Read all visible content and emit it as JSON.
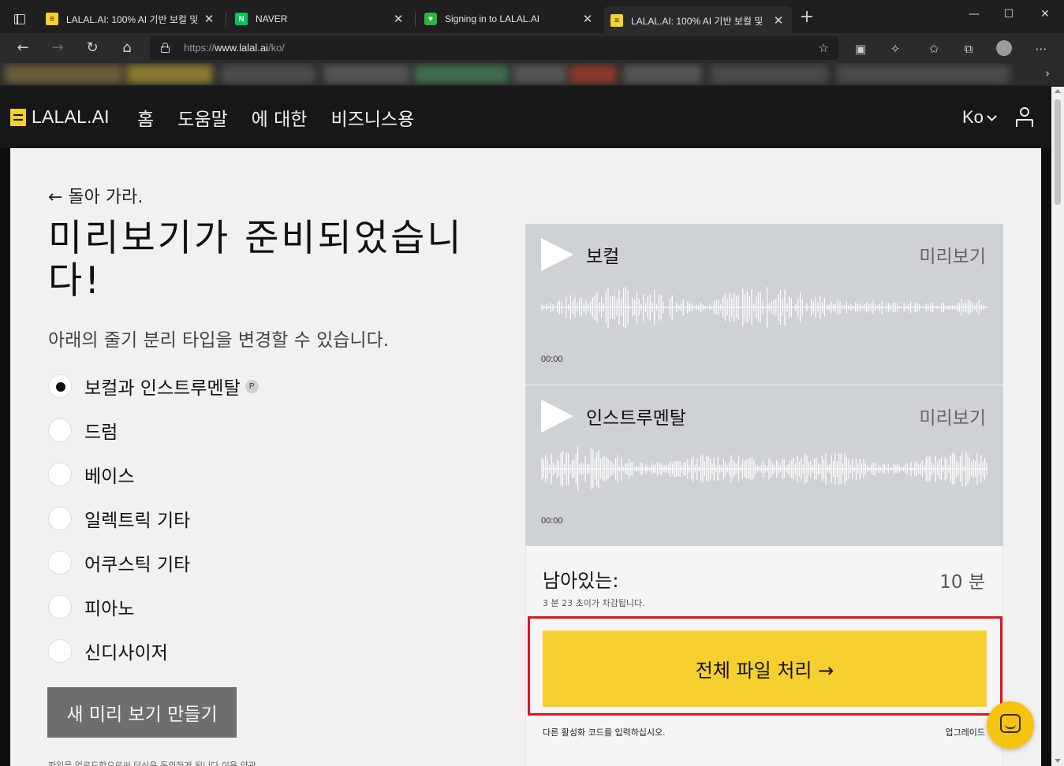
{
  "browser": {
    "tabs": [
      {
        "title": "LALAL.AI: 100% AI 기반 보컬 및 ",
        "favicon_color": "#f6d02e"
      },
      {
        "title": "NAVER",
        "favicon_color": "#03c75a"
      },
      {
        "title": "Signing in to LALAL.AI",
        "favicon_color": "#2fb344"
      },
      {
        "title": "LALAL.AI: 100% AI 기반 보컬 및 ",
        "favicon_color": "#f6d02e",
        "active": true
      }
    ],
    "new_tab": "+",
    "window": {
      "minimize": "—",
      "maximize": "☐",
      "close": "✕"
    },
    "url_scheme": "https://",
    "url_host": "www.lalal.ai",
    "url_path": "/ko/"
  },
  "site": {
    "logo": "LALAL.AI",
    "nav": [
      "홈",
      "도움말",
      "에 대한",
      "비즈니스용"
    ],
    "lang": "Ko",
    "accent": "#f6d02e"
  },
  "main": {
    "back": "← 돌아 가라.",
    "headline": "미리보기가 준비되었습니다!",
    "subline": "아래의 줄기 분리 타입을 변경할 수 있습니다.",
    "options": [
      {
        "label": "보컬과 인스트루멘탈",
        "selected": true,
        "badge": "P"
      },
      {
        "label": "드럼",
        "selected": false
      },
      {
        "label": "베이스",
        "selected": false
      },
      {
        "label": "일렉트릭 기타",
        "selected": false
      },
      {
        "label": "어쿠스틱 기타",
        "selected": false
      },
      {
        "label": "피아노",
        "selected": false
      },
      {
        "label": "신디사이저",
        "selected": false
      }
    ],
    "new_preview_button": "새 미리 보기 만들기",
    "footnote": "파일을 업로드함으로써 당신은 동의하게 됩니다 이용 약관"
  },
  "panel": {
    "tracks": [
      {
        "name": "보컬",
        "preview": "미리보기",
        "time": "00:00"
      },
      {
        "name": "인스트루멘탈",
        "preview": "미리보기",
        "time": "00:00"
      }
    ],
    "remaining_label": "남아있는:",
    "remaining_value": "10 분",
    "deduct_note": "3 분 23 초이가 차감됩니다.",
    "process_button": "전체 파일 처리 →",
    "code_link": "다른 활성화 코드를 입력하십시오.",
    "upgrade": "업그레이드"
  }
}
